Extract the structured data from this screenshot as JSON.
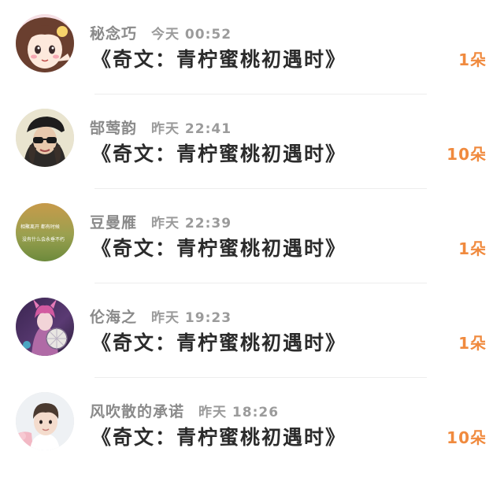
{
  "colors": {
    "accent": "#f08a3e",
    "name": "#8a8a8a",
    "time": "#9b9b9b",
    "title": "#2b2b2b",
    "divider": "#ededed"
  },
  "items": [
    {
      "name": "秘念巧",
      "time": "今天 00:52",
      "title": "《奇文：青柠蜜桃初遇时》",
      "count": "1朵",
      "avatar_icon": "anime-girl-avatar"
    },
    {
      "name": "郜莺韵",
      "time": "昨天 22:41",
      "title": "《奇文：青柠蜜桃初遇时》",
      "count": "10朵",
      "avatar_icon": "sunglasses-woman-avatar"
    },
    {
      "name": "豆曼雁",
      "time": "昨天 22:39",
      "title": "《奇文：青柠蜜桃初遇时》",
      "count": "1朵",
      "avatar_icon": "quote-text-avatar",
      "avatar_text": [
        "相聚离开 都有时候",
        "没有什么会永垂不朽"
      ]
    },
    {
      "name": "伦海之",
      "time": "昨天 19:23",
      "title": "《奇文：青柠蜜桃初遇时》",
      "count": "1朵",
      "avatar_icon": "game-character-avatar"
    },
    {
      "name": "风吹散的承诺",
      "time": "昨天 18:26",
      "title": "《奇文：青柠蜜桃初遇时》",
      "count": "10朵",
      "avatar_icon": "boy-portrait-avatar"
    }
  ]
}
